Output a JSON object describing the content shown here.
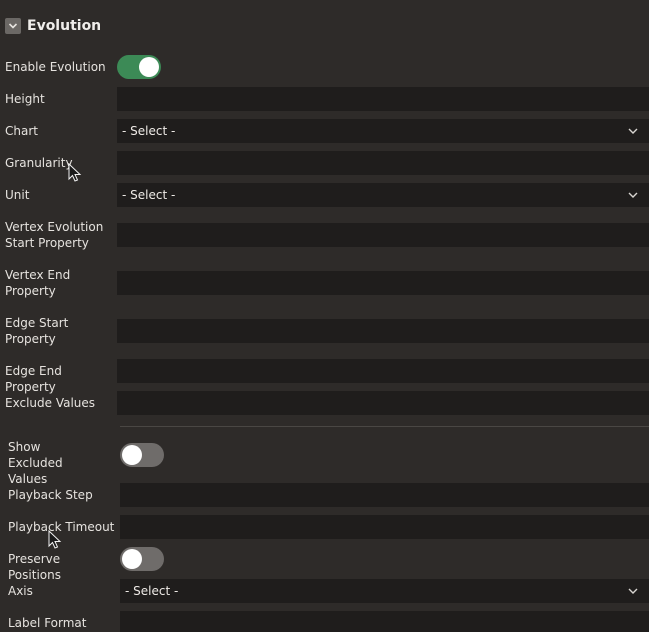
{
  "section": {
    "title": "Evolution",
    "collapse_icon": "chevron-down-icon"
  },
  "fields": {
    "enable_evolution": {
      "label": "Enable Evolution",
      "checked": true
    },
    "height": {
      "label": "Height",
      "value": ""
    },
    "chart": {
      "label": "Chart",
      "value": "- Select -"
    },
    "granularity": {
      "label": "Granularity",
      "value": ""
    },
    "unit": {
      "label": "Unit",
      "value": "- Select -"
    },
    "vertex_evolution_start": {
      "label": "Vertex Evolution Start Property",
      "value": ""
    },
    "vertex_end": {
      "label": "Vertex End Property",
      "value": ""
    },
    "edge_start": {
      "label": "Edge Start Property",
      "value": ""
    },
    "edge_end": {
      "label": "Edge End Property",
      "value": ""
    },
    "exclude_values": {
      "label": "Exclude Values",
      "value": ""
    },
    "show_excluded": {
      "label": "Show Excluded Values",
      "checked": false
    },
    "playback_step": {
      "label": "Playback Step",
      "value": ""
    },
    "playback_timeout": {
      "label": "Playback Timeout",
      "value": ""
    },
    "preserve_positions": {
      "label": "Preserve Positions",
      "checked": false
    },
    "axis": {
      "label": "Axis",
      "value": "- Select -"
    },
    "label_format": {
      "label": "Label Format",
      "value": ""
    }
  },
  "colors": {
    "background": "#2e2b29",
    "field": "#1f1d1c",
    "toggle_on": "#3c8a56",
    "toggle_off": "#6f6c6a"
  }
}
